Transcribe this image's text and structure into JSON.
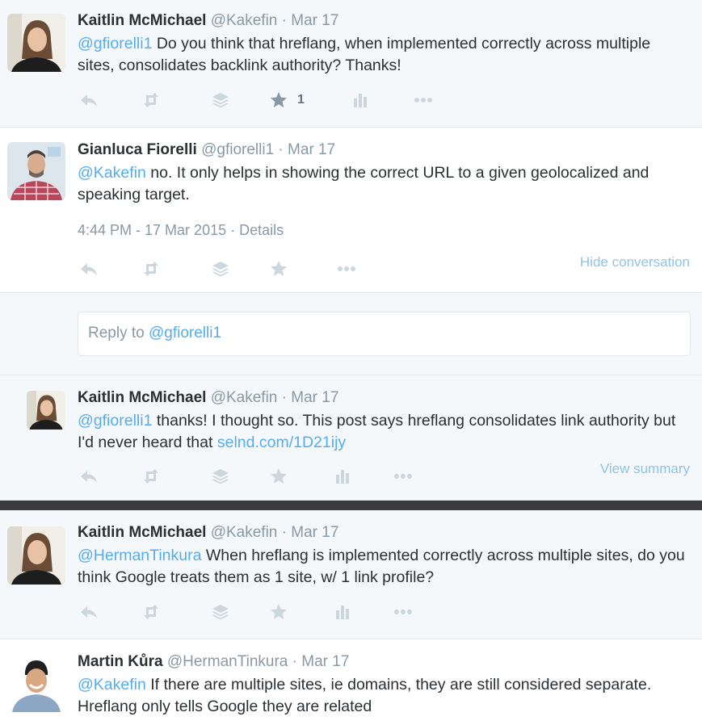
{
  "colors": {
    "link": "#55acee",
    "muted": "#8899a6",
    "icon": "#ccd6dd",
    "separator": "#3b3b3f"
  },
  "icons": {
    "reply": "reply-arrow-icon",
    "retweet": "retweet-icon",
    "bookmark": "layers-icon",
    "favorite": "star-icon",
    "analytics": "bar-chart-icon",
    "more": "more-dots-icon"
  },
  "tweets": [
    {
      "fullname": "Kaitlin McMichael",
      "username": "@Kakefin",
      "time": "Mar 17",
      "mention": "@gfiorelli1",
      "text": " Do you think that hreflang, when implemented correctly across multiple sites, consolidates backlink authority? Thanks!",
      "favorite_count": "1"
    },
    {
      "fullname": "Gianluca Fiorelli",
      "username": "@gfiorelli1",
      "time": "Mar 17",
      "mention": "@Kakefin",
      "text": " no. It only helps in showing the correct URL to a given geolocalized and speaking target.",
      "timestamp": "4:44 PM - 17 Mar 2015",
      "details": "Details",
      "hide_conversation": "Hide conversation"
    },
    {
      "fullname": "Kaitlin McMichael",
      "username": "@Kakefin",
      "time": "Mar 17",
      "mention": "@gfiorelli1",
      "text_before_link": " thanks! I thought so. This post says hreflang consolidates link authority but I'd never heard that ",
      "link": "selnd.com/1D21ijy",
      "view_summary": "View summary"
    },
    {
      "fullname": "Kaitlin McMichael",
      "username": "@Kakefin",
      "time": "Mar 17",
      "mention": "@HermanTinkura",
      "text": " When hreflang is implemented correctly across multiple sites, do you think Google treats them as 1 site, w/ 1 link profile?"
    },
    {
      "fullname": "Martin Kůra",
      "username": "@HermanTinkura",
      "time": "Mar 17",
      "mention": "@Kakefin",
      "text": " If there are multiple sites, ie domains, they are still considered separate. Hreflang only tells Google they are related"
    }
  ],
  "reply_box": {
    "prefix": "Reply to ",
    "mention": "@gfiorelli1"
  },
  "dot": " · "
}
